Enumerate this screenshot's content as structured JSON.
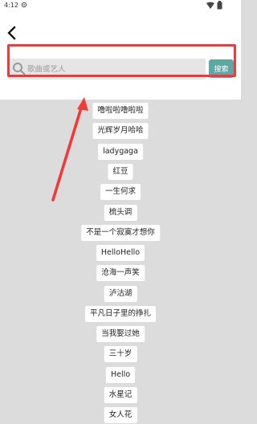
{
  "status_bar": {
    "time": "4:12"
  },
  "search": {
    "placeholder": "歌曲或艺人",
    "button_label": "搜索"
  },
  "suggestions": [
    "噜啦啦噜啦啦",
    "光辉岁月哈哈",
    "ladygaga",
    "红豆",
    "一生何求",
    "梳头调",
    "不是一个寂寞才想你",
    "HelloHello",
    "沧海一声笑",
    "泸沽湖",
    "平凡日子里的挣扎",
    "当我娶过她",
    "三十岁",
    "Hello",
    "水星记",
    "女人花"
  ],
  "colors": {
    "accent": "#5fa7a3",
    "highlight": "#f03a3a",
    "background": "#dcdcdc"
  }
}
